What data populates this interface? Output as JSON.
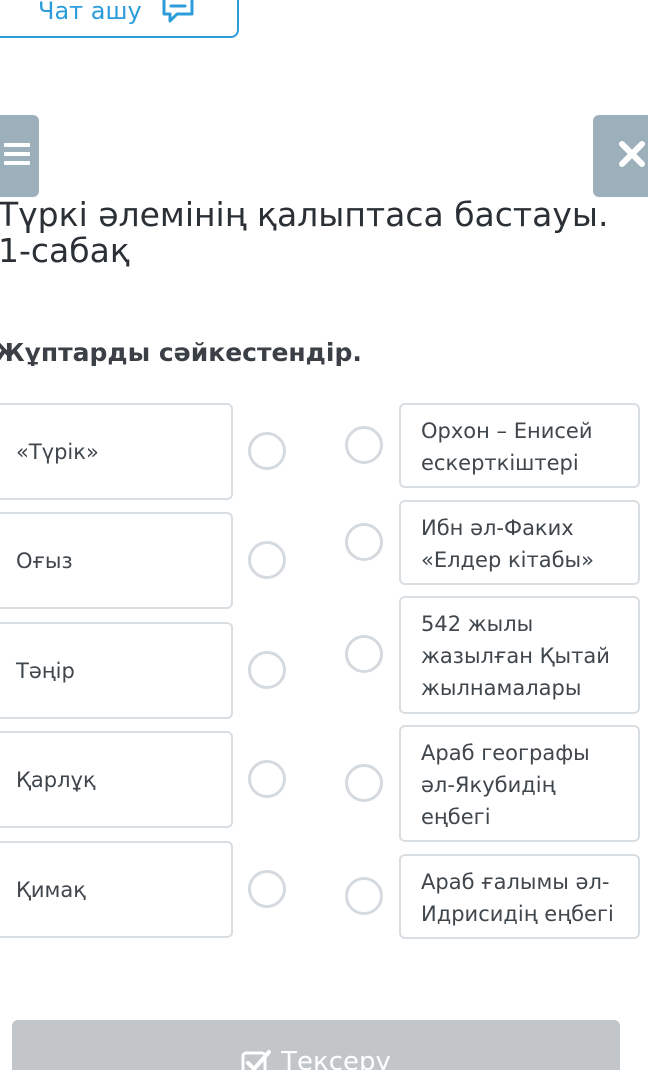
{
  "chat_button": {
    "label": "Чат ашу",
    "icon": "chat-bubble-icon"
  },
  "menu_button": {
    "icon": "hamburger-menu-icon"
  },
  "close_button": {
    "icon": "close-icon"
  },
  "title": "Түркі әлемінің қалыптаса бастауы. 1-сабақ",
  "instruction": "Жұптарды сәйкестендір.",
  "left_items": [
    {
      "label": "«Түрік»"
    },
    {
      "label": "Оғыз"
    },
    {
      "label": "Тәңір"
    },
    {
      "label": "Қарлұқ"
    },
    {
      "label": "Қимақ"
    }
  ],
  "right_items": [
    {
      "label": "Орхон – Енисей ескерткіштері"
    },
    {
      "label": "Ибн әл-Факих «Елдер кітабы»"
    },
    {
      "label": "542 жылы жазылған Қытай жылнамалары"
    },
    {
      "label": "Араб географы әл-Якубидің еңбегі"
    },
    {
      "label": "Араб ғалымы әл-Идрисидің еңбегі"
    }
  ],
  "check_button": {
    "label": "Тексеру",
    "icon": "checkbox-check-icon"
  },
  "colors": {
    "accent": "#2d9cdb",
    "square_button": "#9bb0ba",
    "card_border": "#d9dee2",
    "check_button": "#c3c6c9"
  }
}
